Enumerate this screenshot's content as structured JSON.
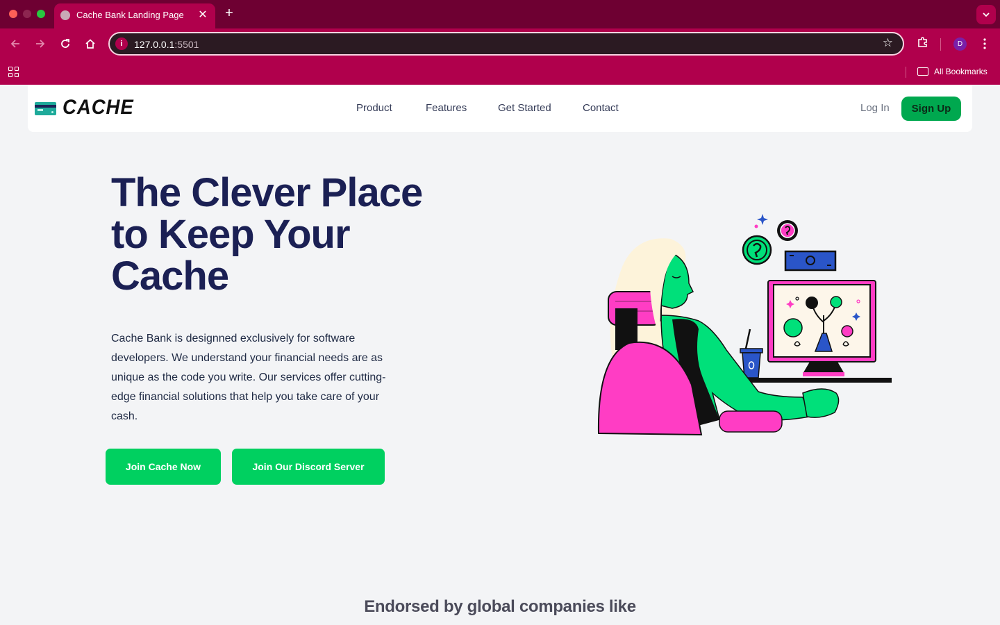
{
  "browser": {
    "tab_title": "Cache Bank Landing Page",
    "tab_close": "✕",
    "new_tab": "+",
    "url_host": "127.0.0.1",
    "url_port": ":5501",
    "profile_initial": "D",
    "bookmarks_label": "All Bookmarks"
  },
  "navbar": {
    "logo_text": "CACHE",
    "links": [
      "Product",
      "Features",
      "Get Started",
      "Contact"
    ],
    "login_label": "Log In",
    "signup_label": "Sign Up"
  },
  "hero": {
    "title_lines": [
      "The Clever Place",
      "to Keep Your",
      "Cache"
    ],
    "description": "Cache Bank is designned exclusively for software developers. We understand your financial needs are as unique as the code you write. Our services offer cutting-edge financial solutions that help you take care of your cash.",
    "primary_cta": "Join Cache Now",
    "secondary_cta": "Join Our Discord Server"
  },
  "endorsed": {
    "heading": "Endorsed by global companies like"
  },
  "colors": {
    "browser_frame": "#b0004c",
    "tab_strip": "#6e0032",
    "brand_green": "#00d060",
    "heading_navy": "#1b2054",
    "illustration_pink": "#ff3dc4",
    "illustration_green": "#00e07a"
  }
}
